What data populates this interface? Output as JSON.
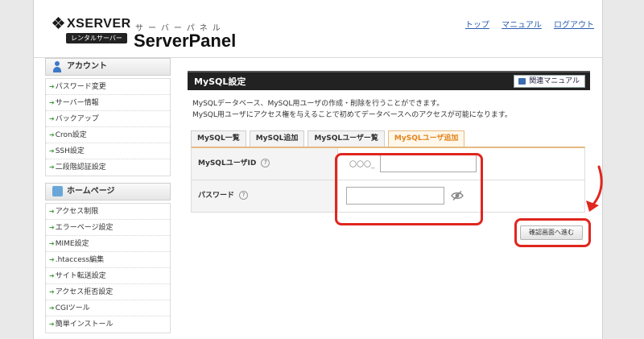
{
  "header": {
    "logo_brand": "XSERVER",
    "logo_badge": "レンタルサーバー",
    "logo_kana": "サーバーパネル",
    "logo_title": "ServerPanel",
    "links": [
      "トップ",
      "マニュアル",
      "ログアウト"
    ]
  },
  "sidebar": {
    "sections": [
      {
        "title": "アカウント",
        "icon": "user-icon",
        "items": [
          "パスワード変更",
          "サーバー情報",
          "バックアップ",
          "Cron設定",
          "SSH設定",
          "二段階認証設定"
        ]
      },
      {
        "title": "ホームページ",
        "icon": "home-page-icon",
        "items": [
          "アクセス制限",
          "エラーページ設定",
          "MIME設定",
          ".htaccess編集",
          "サイト転送設定",
          "アクセス拒否設定",
          "CGIツール",
          "簡単インストール"
        ]
      }
    ]
  },
  "main": {
    "title": "MySQL設定",
    "manual_button": "関連マニュアル",
    "desc_line1": "MySQLデータベース、MySQL用ユーザの作成・削除を行うことができます。",
    "desc_line2": "MySQL用ユーザにアクセス権を与えることで初めてデータベースへのアクセスが可能になります。",
    "tabs": [
      {
        "label": "MySQL一覧",
        "active": false
      },
      {
        "label": "MySQL追加",
        "active": false
      },
      {
        "label": "MySQLユーザー覧",
        "active": false
      },
      {
        "label": "MySQLユーザ追加",
        "active": true
      }
    ],
    "form": {
      "user_id_label": "MySQLユーザID",
      "user_id_prefix": "〇〇〇_",
      "user_id_value": "",
      "password_label": "パスワード",
      "password_value": "",
      "help_glyph": "?"
    },
    "confirm_button": "確認画面へ進む"
  },
  "colors": {
    "accent_orange": "#e2831a",
    "highlight_red": "#e0261f",
    "titlebar": "#222222"
  }
}
